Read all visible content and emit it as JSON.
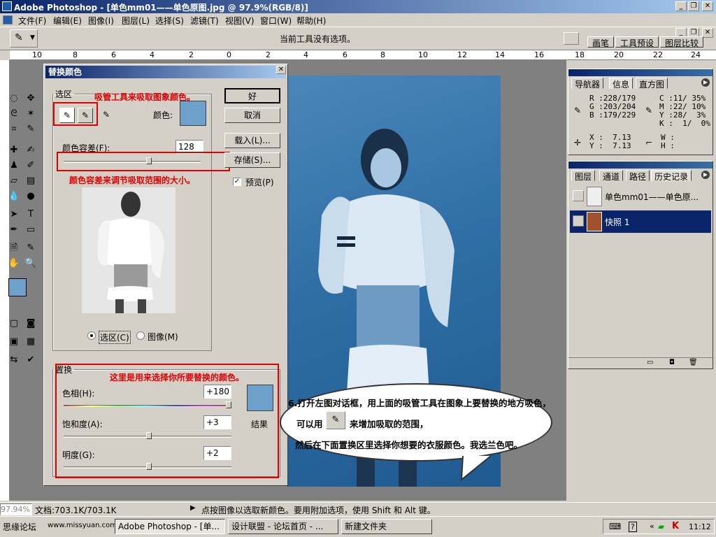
{
  "window": {
    "title": "Adobe Photoshop - [单色mm01——单色原图.jpg @ 97.9%(RGB/8)]",
    "minimize": "_",
    "restore": "❐",
    "close": "✕"
  },
  "menu": [
    "文件(F)",
    "编辑(E)",
    "图像(I)",
    "图层(L)",
    "选择(S)",
    "滤镜(T)",
    "视图(V)",
    "窗口(W)",
    "帮助(H)"
  ],
  "options_bar": {
    "message": "当前工具没有选项。",
    "dock_tabs": [
      "画笔",
      "工具预设",
      "图层比较"
    ]
  },
  "ruler_ticks": [
    "10",
    "8",
    "6",
    "4",
    "2",
    "0",
    "2",
    "4",
    "6",
    "8",
    "10",
    "12",
    "14",
    "16",
    "18",
    "20",
    "22",
    "24"
  ],
  "dialog": {
    "title": "替换颜色",
    "close": "✕",
    "selection_legend": "选区",
    "color_label": "颜色:",
    "fuzziness_label": "颜色容差(F):",
    "fuzziness_value": "128",
    "radio_selection": "选区(C)",
    "radio_image": "图像(M)",
    "replace_legend": "置换",
    "hue_label": "色相(H):",
    "hue_value": "+180",
    "saturation_label": "饱和度(A):",
    "saturation_value": "+3",
    "lightness_label": "明度(G):",
    "lightness_value": "+2",
    "result_label": "结果",
    "ok": "好",
    "cancel": "取消",
    "load": "载入(L)...",
    "save": "存储(S)...",
    "preview": "预览(P)",
    "slider_levels": {
      "fuzziness": 0.63,
      "hue": 1.0,
      "saturation": 0.51,
      "lightness": 0.51
    },
    "annotations": {
      "eyedropper": "吸管工具来吸取图象颜色。",
      "fuzziness": "颜色容差来调节吸取范围的大小。",
      "replace": "这里是用来选择你所要替换的颜色。"
    },
    "colors": {
      "picked": "#6ea0cc",
      "result": "#6ea0cc",
      "annotation": "#e00000"
    }
  },
  "info_panel": {
    "tabs": [
      "导航器",
      "信息",
      "直方图"
    ],
    "rgb": [
      "R :228/179",
      "G :203/204",
      "B :179/229"
    ],
    "cmyk": [
      "C :11/ 35%",
      "M :22/ 10%",
      "Y :28/  3%",
      "K :  1/  0%"
    ],
    "xy": [
      "X :  7.13",
      "Y :  7.13"
    ],
    "wh": [
      "W :",
      "H :"
    ]
  },
  "layers_panel": {
    "tabs": [
      "图层",
      "通道",
      "路径",
      "历史记录"
    ],
    "items": [
      "单色mm01——单色原...",
      "快照 1"
    ]
  },
  "callout": {
    "lines": [
      "6.打开左图对话框，用上面的吸管工具在图象上要替换的地方吸色，",
      "可以用",
      "来增加吸取的范围，",
      "然后在下面置换区里选择你想要的衣服颜色。我选兰色吧。"
    ]
  },
  "status": {
    "zoom": "97.94%",
    "doc": "文档:703.1K/703.1K",
    "hint": "点按图像以选取新颜色。要用附加选项，使用 Shift 和 Alt 键。"
  },
  "taskbar": {
    "items": [
      "思缘论坛",
      "www.missyuan.com",
      "Adobe Photoshop - [单...",
      "设计联盟 - 论坛首页 - ...",
      "新建文件夹"
    ],
    "clock": "11:12"
  }
}
